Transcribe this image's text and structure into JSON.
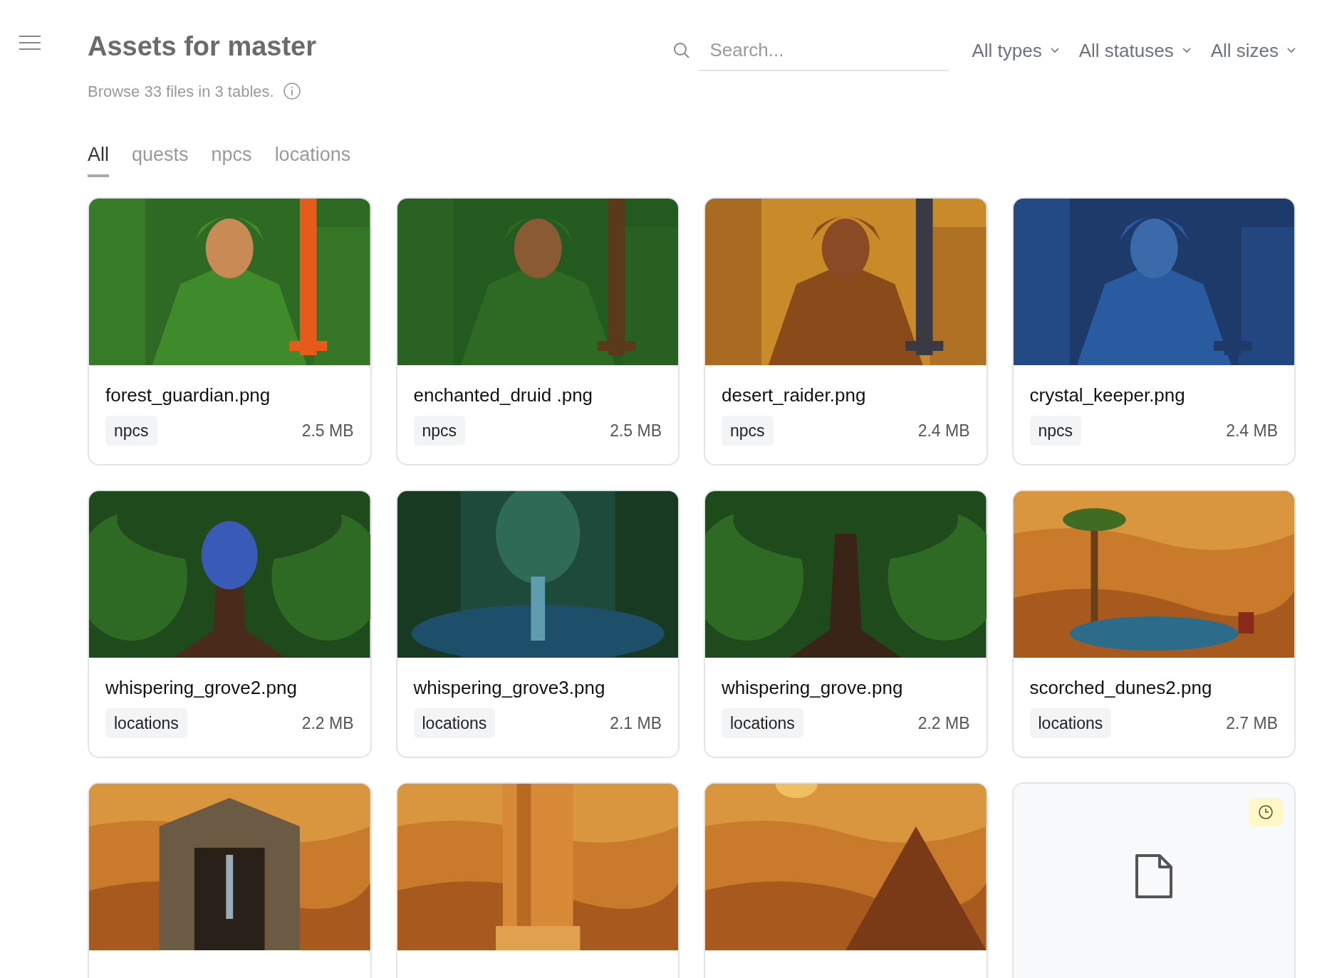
{
  "header": {
    "title": "Assets for master",
    "subtitle": "Browse 33 files in 3 tables."
  },
  "search": {
    "placeholder": "Search..."
  },
  "filters": [
    {
      "label": "All types"
    },
    {
      "label": "All statuses"
    },
    {
      "label": "All sizes"
    }
  ],
  "tabs": [
    {
      "label": "All",
      "selected": true
    },
    {
      "label": "quests",
      "selected": false
    },
    {
      "label": "npcs",
      "selected": false
    },
    {
      "label": "locations",
      "selected": false
    }
  ],
  "assets": [
    {
      "kind": "picture",
      "name": "forest_guardian.png",
      "table": "npcs",
      "size": "2.5 MB"
    },
    {
      "kind": "picture",
      "name": "enchanted_druid .png",
      "table": "npcs",
      "size": "2.5 MB"
    },
    {
      "kind": "picture",
      "name": "desert_raider.png",
      "table": "npcs",
      "size": "2.4 MB"
    },
    {
      "kind": "picture",
      "name": "crystal_keeper.png",
      "table": "npcs",
      "size": "2.4 MB"
    },
    {
      "kind": "picture",
      "name": "whispering_grove2.png",
      "table": "locations",
      "size": "2.2 MB"
    },
    {
      "kind": "picture",
      "name": "whispering_grove3.png",
      "table": "locations",
      "size": "2.1 MB"
    },
    {
      "kind": "picture",
      "name": "whispering_grove.png",
      "table": "locations",
      "size": "2.2 MB"
    },
    {
      "kind": "picture",
      "name": "scorched_dunes2.png",
      "table": "locations",
      "size": "2.7 MB"
    },
    {
      "kind": "picture"
    },
    {
      "kind": "picture"
    },
    {
      "kind": "picture"
    },
    {
      "kind": "placeholder",
      "pending": true
    }
  ]
}
